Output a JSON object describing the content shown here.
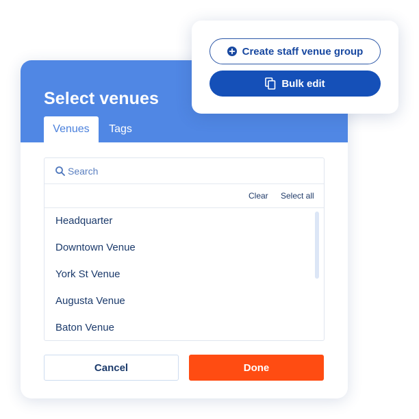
{
  "dialog": {
    "title": "Select venues",
    "tabs": [
      {
        "label": "Venues",
        "active": true
      },
      {
        "label": "Tags",
        "active": false
      }
    ],
    "search": {
      "placeholder": "Search",
      "value": ""
    },
    "actions": {
      "clear_label": "Clear",
      "select_all_label": "Select all"
    },
    "venues": [
      "Headquarter",
      "Downtown Venue",
      "York St Venue",
      "Augusta Venue",
      "Baton Venue"
    ],
    "footer": {
      "cancel_label": "Cancel",
      "done_label": "Done"
    }
  },
  "popover": {
    "create_label": "Create staff venue group",
    "create_icon": "plus-circle-icon",
    "bulk_edit_label": "Bulk edit",
    "bulk_edit_icon": "copy-icon"
  },
  "colors": {
    "header_bg": "#5087e4",
    "primary_text": "#1b3a6b",
    "done_button": "#ff4c12",
    "bulk_edit_button": "#1550b8",
    "outline_button_border": "#2b56a6"
  }
}
